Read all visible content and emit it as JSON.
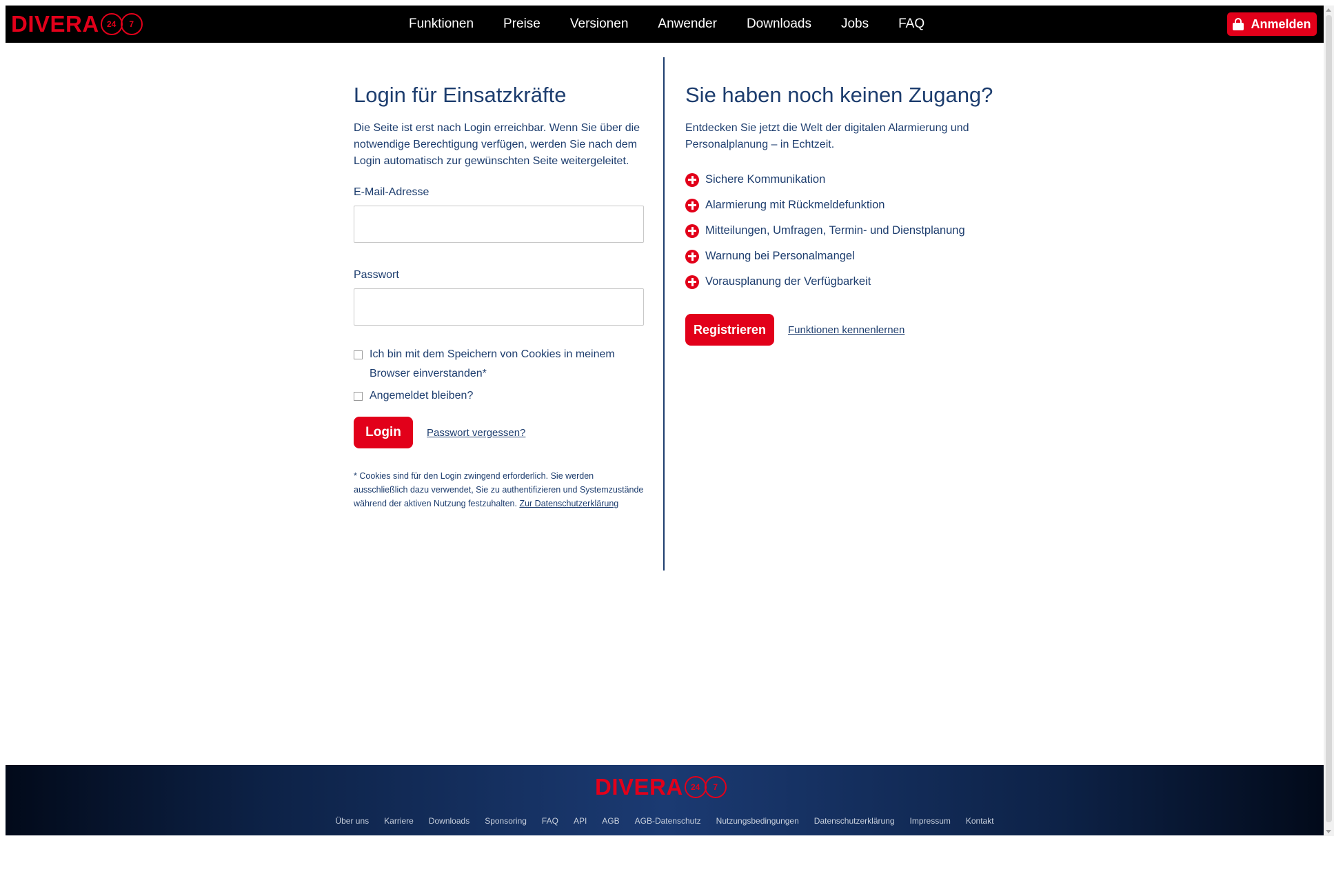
{
  "header": {
    "logo_word": "DIVERA",
    "logo_num1": "24",
    "logo_num2": "7",
    "nav": [
      "Funktionen",
      "Preise",
      "Versionen",
      "Anwender",
      "Downloads",
      "Jobs",
      "FAQ"
    ],
    "login_label": "Anmelden"
  },
  "login": {
    "title": "Login für Einsatzkräfte",
    "intro": "Die Seite ist erst nach Login erreichbar. Wenn Sie über die notwendige Berechtigung verfügen, werden Sie nach dem Login automatisch zur gewünschten Seite weitergeleitet.",
    "email_label": "E-Mail-Adresse",
    "email_value": "",
    "password_label": "Passwort",
    "password_value": "",
    "cookies_label": "Ich bin mit dem Speichern von Cookies in meinem Browser einverstanden*",
    "remember_label": "Angemeldet bleiben?",
    "submit_label": "Login",
    "forgot_label": "Passwort vergessen?",
    "footnote": "* Cookies sind für den Login zwingend erforderlich. Sie werden ausschließlich dazu verwendet, Sie zu authentifizieren und Systemzustände während der aktiven Nutzung festzuhalten.",
    "privacy_link": "Zur Datenschutzerklärung"
  },
  "signup": {
    "title": "Sie haben noch keinen Zugang?",
    "intro": "Entdecken Sie jetzt die Welt der digitalen Alarmierung und Personalplanung – in Echtzeit.",
    "features": [
      "Sichere Kommunikation",
      "Alarmierung mit Rückmeldefunktion",
      "Mitteilungen, Umfragen, Termin- und Dienstplanung",
      "Warnung bei Personalmangel",
      "Vorausplanung der Verfügbarkeit"
    ],
    "register_label": "Registrieren",
    "functions_link": "Funktionen kennenlernen"
  },
  "footer": {
    "links": [
      "Über uns",
      "Karriere",
      "Downloads",
      "Sponsoring",
      "FAQ",
      "API",
      "AGB",
      "AGB-Datenschutz",
      "Nutzungsbedingungen",
      "Datenschutzerklärung",
      "Impressum",
      "Kontakt"
    ]
  },
  "colors": {
    "brand_red": "#e2001a",
    "navy": "#1d3d6e",
    "header_bg": "#000000"
  }
}
